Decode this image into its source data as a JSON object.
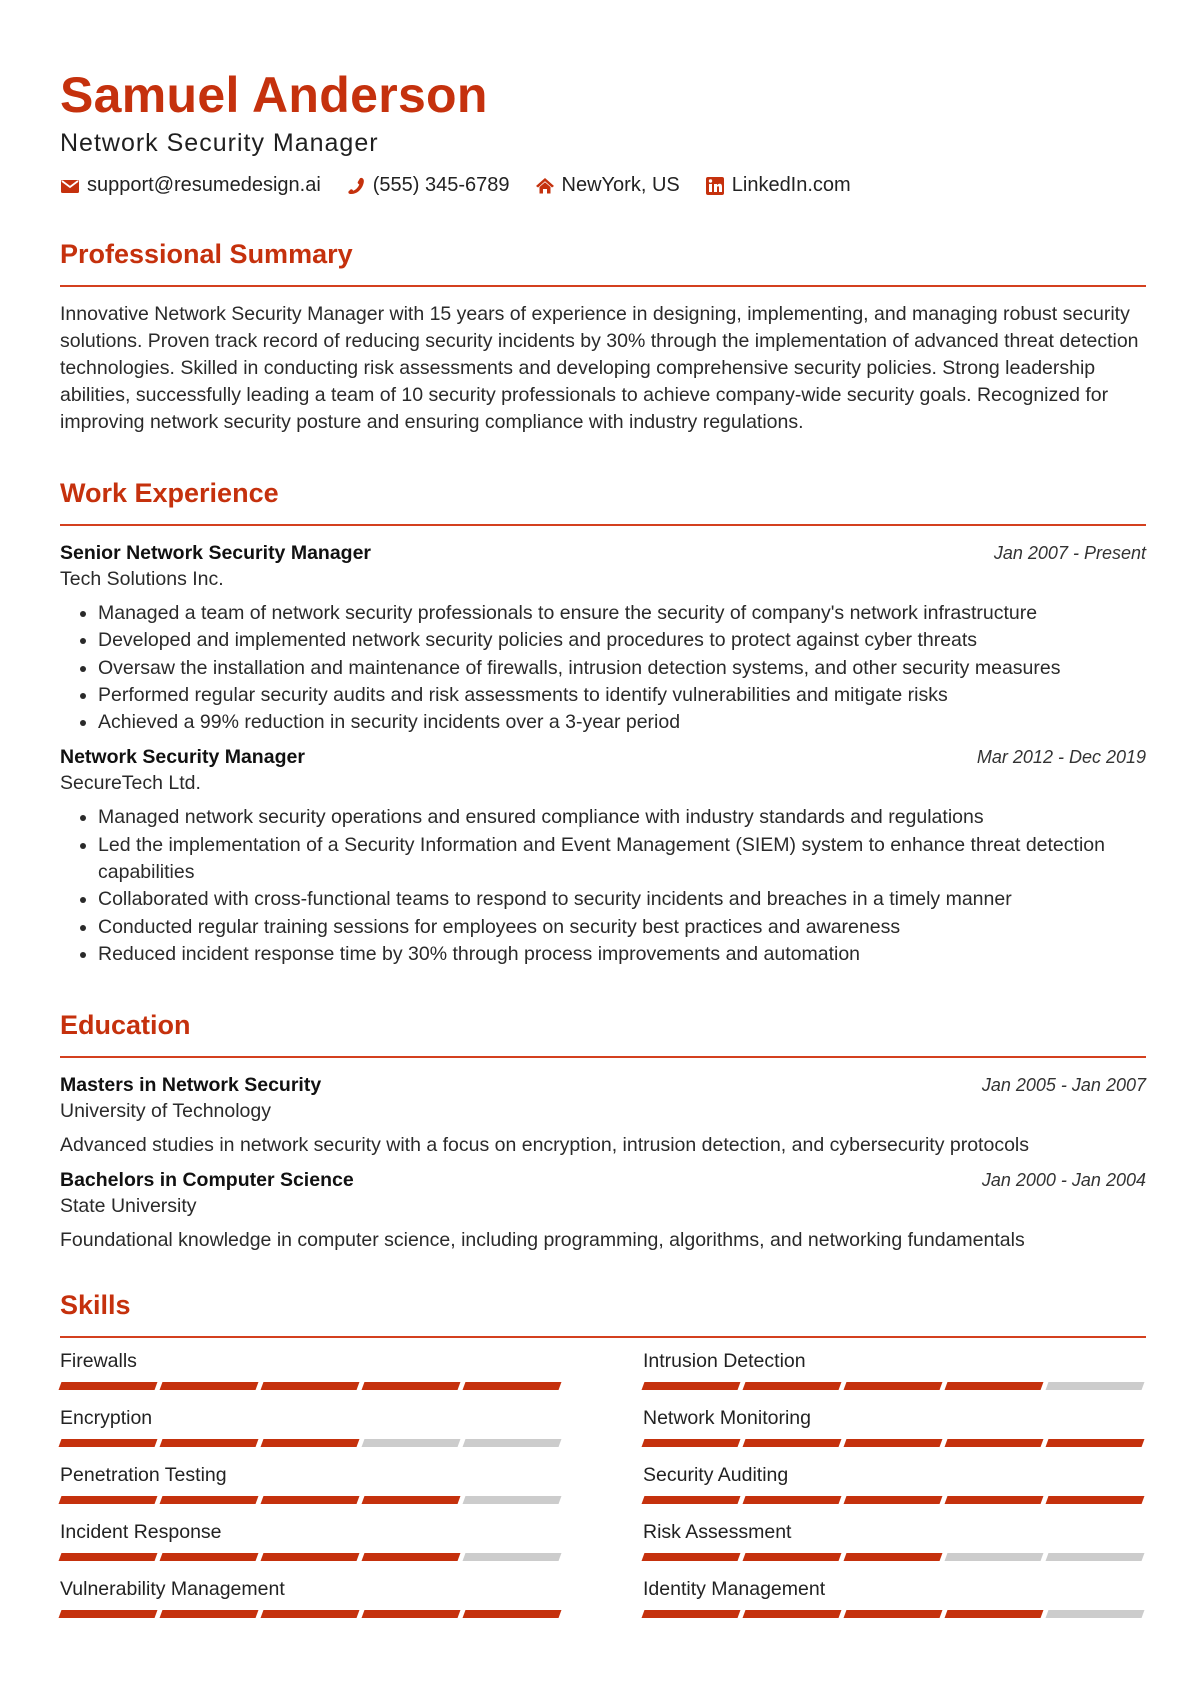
{
  "header": {
    "name": "Samuel Anderson",
    "title": "Network Security Manager",
    "contacts": [
      {
        "icon": "envelope-icon",
        "text": "support@resumedesign.ai"
      },
      {
        "icon": "phone-icon",
        "text": "(555) 345-6789"
      },
      {
        "icon": "home-icon",
        "text": "NewYork, US"
      },
      {
        "icon": "linkedin-icon",
        "text": "LinkedIn.com"
      }
    ]
  },
  "colors": {
    "accent": "#c5310d",
    "bar_empty": "#cccccc"
  },
  "summary": {
    "title": "Professional Summary",
    "text": "Innovative Network Security Manager with 15 years of experience in designing, implementing, and managing robust security solutions. Proven track record of reducing security incidents by 30% through the implementation of advanced threat detection technologies. Skilled in conducting risk assessments and developing comprehensive security policies. Strong leadership abilities, successfully leading a team of 10 security professionals to achieve company-wide security goals. Recognized for improving network security posture and ensuring compliance with industry regulations."
  },
  "experience": {
    "title": "Work Experience",
    "jobs": [
      {
        "role": "Senior Network Security Manager",
        "company": "Tech Solutions Inc.",
        "dates": "Jan 2007 - Present",
        "bullets": [
          "Managed a team of network security professionals to ensure the security of company's network infrastructure",
          "Developed and implemented network security policies and procedures to protect against cyber threats",
          "Oversaw the installation and maintenance of firewalls, intrusion detection systems, and other security measures",
          "Performed regular security audits and risk assessments to identify vulnerabilities and mitigate risks",
          "Achieved a 99% reduction in security incidents over a 3-year period"
        ]
      },
      {
        "role": "Network Security Manager",
        "company": "SecureTech Ltd.",
        "dates": "Mar 2012 - Dec 2019",
        "bullets": [
          "Managed network security operations and ensured compliance with industry standards and regulations",
          "Led the implementation of a Security Information and Event Management (SIEM) system to enhance threat detection capabilities",
          "Collaborated with cross-functional teams to respond to security incidents and breaches in a timely manner",
          "Conducted regular training sessions for employees on security best practices and awareness",
          "Reduced incident response time by 30% through process improvements and automation"
        ]
      }
    ]
  },
  "education": {
    "title": "Education",
    "items": [
      {
        "degree": "Masters in Network Security",
        "school": "University of Technology",
        "dates": "Jan 2005 - Jan 2007",
        "description": "Advanced studies in network security with a focus on encryption, intrusion detection, and cybersecurity protocols"
      },
      {
        "degree": "Bachelors in Computer Science",
        "school": "State University",
        "dates": "Jan 2000 - Jan 2004",
        "description": "Foundational knowledge in computer science, including programming, algorithms, and networking fundamentals"
      }
    ]
  },
  "skills": {
    "title": "Skills",
    "max_level": 5,
    "items": [
      {
        "name": "Firewalls",
        "level": 5
      },
      {
        "name": "Intrusion Detection",
        "level": 4
      },
      {
        "name": "Encryption",
        "level": 3
      },
      {
        "name": "Network Monitoring",
        "level": 5
      },
      {
        "name": "Penetration Testing",
        "level": 4
      },
      {
        "name": "Security Auditing",
        "level": 5
      },
      {
        "name": "Incident Response",
        "level": 4
      },
      {
        "name": "Risk Assessment",
        "level": 3
      },
      {
        "name": "Vulnerability Management",
        "level": 5
      },
      {
        "name": "Identity Management",
        "level": 4
      }
    ]
  }
}
